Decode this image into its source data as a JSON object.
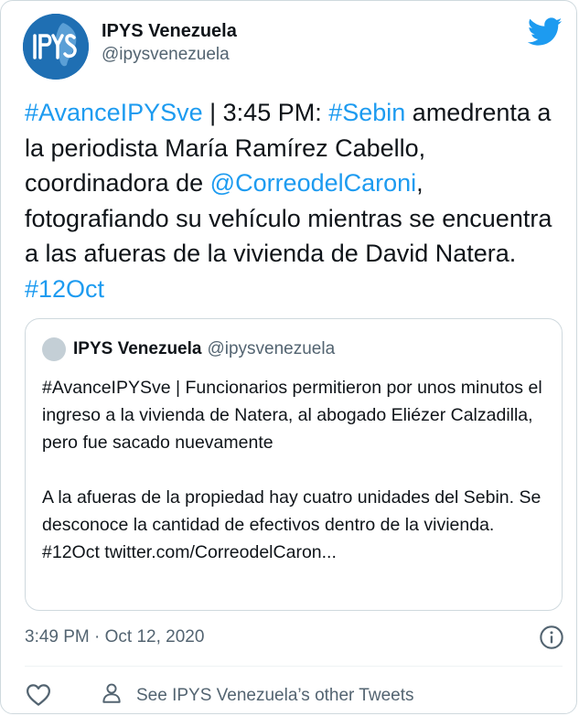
{
  "header": {
    "display_name": "IPYS Venezuela",
    "handle": "@ipysvenezuela",
    "avatar_text": "IPYS",
    "brand_color": "#1d9bf0",
    "avatar_color": "#1f6fb3",
    "bird_icon": "twitter-bird-icon"
  },
  "tweet": {
    "seg1": "#AvanceIPYSve",
    "seg2": " | 3:45 PM: ",
    "seg3": "#Sebin",
    "seg4": " amedrenta a la periodista María Ramírez Cabello, coordinadora de ",
    "seg5": "@CorreodelCaroni",
    "seg6": ", fotografiando su vehículo mientras se encuentra a las afueras de la vivienda de David Natera. ",
    "seg7": "#12Oct"
  },
  "quote": {
    "display_name": "IPYS Venezuela",
    "handle": "@ipysvenezuela",
    "paragraph1": "#AvanceIPYSve | Funcionarios permitieron por unos minutos el ingreso a la vivienda de Natera, al abogado Eliézer Calzadilla, pero fue sacado nuevamente",
    "paragraph2": "A la afueras de la propiedad hay cuatro unidades del Sebin. Se desconoce la cantidad de efectivos dentro de la vivienda. #12Oct twitter.com/CorreodelCaron..."
  },
  "meta": {
    "timestamp": "3:49 PM · Oct 12, 2020",
    "info_icon": "info-icon"
  },
  "actions": {
    "like_icon": "heart-icon",
    "person_icon": "person-icon",
    "other_tweets_label": "See IPYS Venezuela’s other Tweets"
  }
}
